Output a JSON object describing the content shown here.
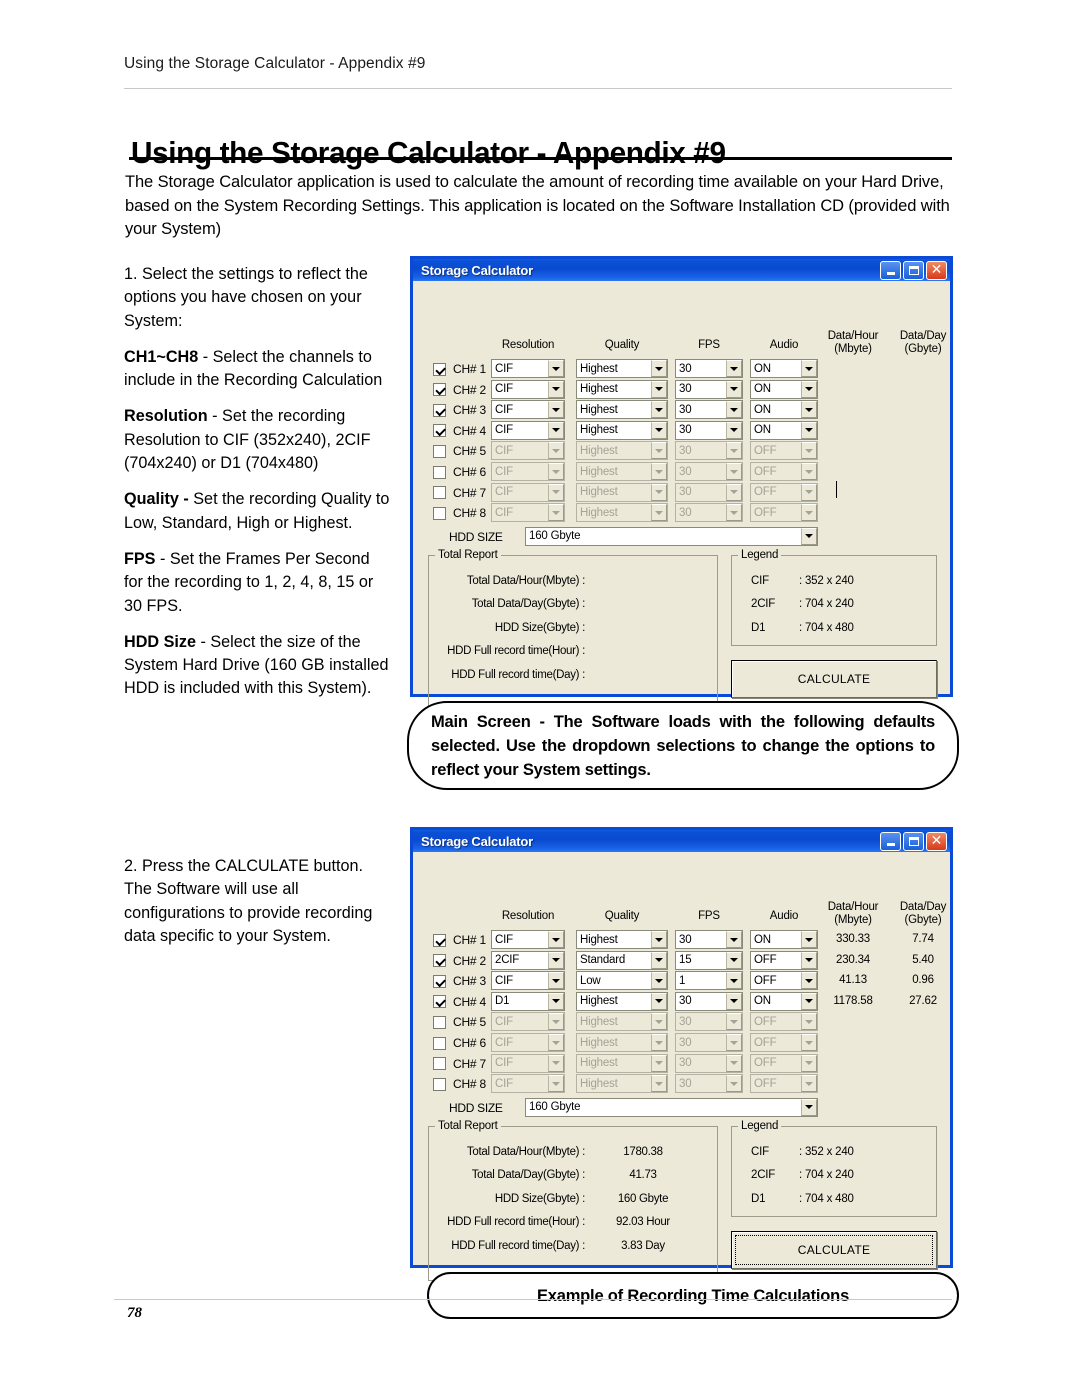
{
  "page": {
    "running_header": "Using the Storage Calculator - Appendix #9",
    "title": "Using the Storage Calculator - Appendix #9",
    "intro": "The Storage Calculator application is used to calculate the amount of recording time available on your Hard Drive, based on the System Recording Settings. This application is located on the Software Installation CD (provided with your System)",
    "page_number": "78"
  },
  "instructions": {
    "step1_intro": "1. Select the settings to reflect the options you have chosen on your System:",
    "ch_term": "CH1~CH8",
    "ch_desc": " - Select the channels to include in the Recording Calculation",
    "res_term": "Resolution",
    "res_desc": " - Set the recording Resolution to CIF (352x240), 2CIF (704x240) or D1 (704x480)",
    "qual_term": "Quality -",
    "qual_desc": " Set the recording Quality to Low, Standard, High or Highest.",
    "fps_term": "FPS",
    "fps_desc": " - Set the Frames Per Second for the recording to 1, 2, 4, 8, 15 or 30 FPS.",
    "hdd_term": "HDD Size",
    "hdd_desc": " - Select the size of the System Hard Drive (160 GB installed HDD is included with this System).",
    "step2": "2. Press the CALCULATE button. The Software will use all configurations to provide recording data specific to your System."
  },
  "callouts": {
    "main_screen": "Main Screen - The Software loads with the following defaults selected. Use the dropdown selections to change the options to reflect your System settings.",
    "example": "Example of Recording Time Calculations"
  },
  "dialog_common": {
    "window_title": "Storage Calculator",
    "window_buttons": [
      "minimize-icon",
      "maximize-icon",
      "close-icon"
    ],
    "column_headers": [
      {
        "line1": "Resolution",
        "line2": ""
      },
      {
        "line1": "Quality",
        "line2": ""
      },
      {
        "line1": "FPS",
        "line2": ""
      },
      {
        "line1": "Audio",
        "line2": ""
      },
      {
        "line1": "Data/Hour",
        "line2": "(Mbyte)"
      },
      {
        "line1": "Data/Day",
        "line2": "(Gbyte)"
      }
    ],
    "hdd_size_label": "HDD SIZE",
    "hdd_size_value": "160 Gbyte",
    "total_report_legend": "Total Report",
    "legend_legend": "Legend",
    "report_labels": [
      "Total Data/Hour(Mbyte) :",
      "Total Data/Day(Gbyte) :",
      "HDD Size(Gbyte) :",
      "HDD Full record time(Hour) :",
      "HDD Full record time(Day) :"
    ],
    "legend_rows": [
      {
        "key": "CIF",
        "value": ": 352 x 240"
      },
      {
        "key": "2CIF",
        "value": ": 704 x 240"
      },
      {
        "key": "D1",
        "value": ": 704 x 480"
      }
    ],
    "calculate_label": "CALCULATE",
    "colors": {
      "titlebar_blue": "#0a4ad6",
      "dialog_face": "#ece9d8",
      "close_red": "#d83a1a",
      "disabled_text": "#a5a296"
    }
  },
  "dialog1": {
    "rows": [
      {
        "label": "CH# 1",
        "checked": true,
        "enabled": true,
        "resolution": "CIF",
        "quality": "Highest",
        "fps": "30",
        "audio": "ON",
        "data_hour": "",
        "data_day": ""
      },
      {
        "label": "CH# 2",
        "checked": true,
        "enabled": true,
        "resolution": "CIF",
        "quality": "Highest",
        "fps": "30",
        "audio": "ON",
        "data_hour": "",
        "data_day": ""
      },
      {
        "label": "CH# 3",
        "checked": true,
        "enabled": true,
        "resolution": "CIF",
        "quality": "Highest",
        "fps": "30",
        "audio": "ON",
        "data_hour": "",
        "data_day": ""
      },
      {
        "label": "CH# 4",
        "checked": true,
        "enabled": true,
        "resolution": "CIF",
        "quality": "Highest",
        "fps": "30",
        "audio": "ON",
        "data_hour": "",
        "data_day": ""
      },
      {
        "label": "CH# 5",
        "checked": false,
        "enabled": false,
        "resolution": "CIF",
        "quality": "Highest",
        "fps": "30",
        "audio": "OFF",
        "data_hour": "",
        "data_day": ""
      },
      {
        "label": "CH# 6",
        "checked": false,
        "enabled": false,
        "resolution": "CIF",
        "quality": "Highest",
        "fps": "30",
        "audio": "OFF",
        "data_hour": "",
        "data_day": ""
      },
      {
        "label": "CH# 7",
        "checked": false,
        "enabled": false,
        "resolution": "CIF",
        "quality": "Highest",
        "fps": "30",
        "audio": "OFF",
        "data_hour": "",
        "data_day": ""
      },
      {
        "label": "CH# 8",
        "checked": false,
        "enabled": false,
        "resolution": "CIF",
        "quality": "Highest",
        "fps": "30",
        "audio": "OFF",
        "data_hour": "",
        "data_day": ""
      }
    ],
    "report_values": [
      "",
      "",
      "",
      "",
      ""
    ],
    "calculate_focused": false
  },
  "dialog2": {
    "rows": [
      {
        "label": "CH# 1",
        "checked": true,
        "enabled": true,
        "resolution": "CIF",
        "quality": "Highest",
        "fps": "30",
        "audio": "ON",
        "data_hour": "330.33",
        "data_day": "7.74"
      },
      {
        "label": "CH# 2",
        "checked": true,
        "enabled": true,
        "resolution": "2CIF",
        "quality": "Standard",
        "fps": "15",
        "audio": "OFF",
        "data_hour": "230.34",
        "data_day": "5.40"
      },
      {
        "label": "CH# 3",
        "checked": true,
        "enabled": true,
        "resolution": "CIF",
        "quality": "Low",
        "fps": "1",
        "audio": "OFF",
        "data_hour": "41.13",
        "data_day": "0.96"
      },
      {
        "label": "CH# 4",
        "checked": true,
        "enabled": true,
        "resolution": "D1",
        "quality": "Highest",
        "fps": "30",
        "audio": "ON",
        "data_hour": "1178.58",
        "data_day": "27.62"
      },
      {
        "label": "CH# 5",
        "checked": false,
        "enabled": false,
        "resolution": "CIF",
        "quality": "Highest",
        "fps": "30",
        "audio": "OFF",
        "data_hour": "",
        "data_day": ""
      },
      {
        "label": "CH# 6",
        "checked": false,
        "enabled": false,
        "resolution": "CIF",
        "quality": "Highest",
        "fps": "30",
        "audio": "OFF",
        "data_hour": "",
        "data_day": ""
      },
      {
        "label": "CH# 7",
        "checked": false,
        "enabled": false,
        "resolution": "CIF",
        "quality": "Highest",
        "fps": "30",
        "audio": "OFF",
        "data_hour": "",
        "data_day": ""
      },
      {
        "label": "CH# 8",
        "checked": false,
        "enabled": false,
        "resolution": "CIF",
        "quality": "Highest",
        "fps": "30",
        "audio": "OFF",
        "data_hour": "",
        "data_day": ""
      }
    ],
    "report_values": [
      "1780.38",
      "41.73",
      "160 Gbyte",
      "92.03 Hour",
      "3.83 Day"
    ],
    "calculate_focused": true
  }
}
